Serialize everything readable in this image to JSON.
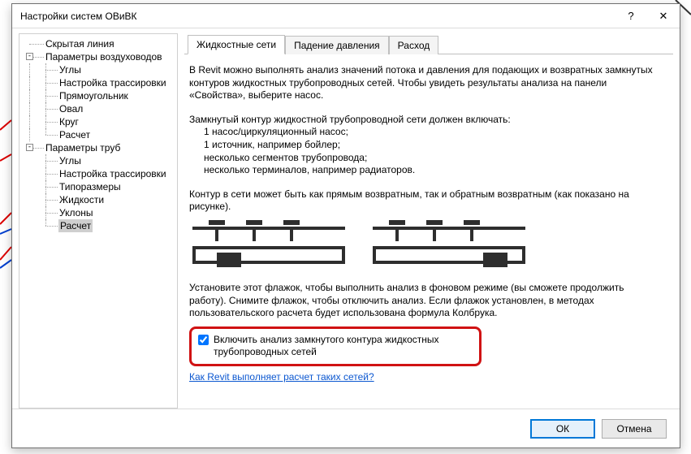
{
  "title": "Настройки систем ОВиВК",
  "titlebar": {
    "help_icon": "?",
    "close_icon": "✕"
  },
  "tree": {
    "n0": "Скрытая линия",
    "n1": "Параметры воздуховодов",
    "n1c": [
      "Углы",
      "Настройка трассировки",
      "Прямоугольник",
      "Овал",
      "Круг",
      "Расчет"
    ],
    "n2": "Параметры труб",
    "n2c": [
      "Углы",
      "Настройка трассировки",
      "Типоразмеры",
      "Жидкости",
      "Уклоны",
      "Расчет"
    ]
  },
  "tabs": {
    "t0": "Жидкостные сети",
    "t1": "Падение давления",
    "t2": "Расход"
  },
  "content": {
    "intro": "В Revit можно выполнять анализ значений потока и давления для подающих и возвратных замкнутых контуров жидкостных трубопроводных сетей. Чтобы увидеть результаты анализа на панели «Свойства», выберите насос.",
    "musthdr": "Замкнутый контур жидкостной трубопроводной сети должен включать:",
    "must1": "1 насос/циркуляционный насос;",
    "must2": "1 источник, например бойлер;",
    "must3": "несколько сегментов трубопровода;",
    "must4": "несколько терминалов, например радиаторов.",
    "loopnote": "Контур в сети может быть как прямым возвратным, так и обратным возвратным (как показано на рисунке).",
    "checkhelp": "Установите этот флажок, чтобы выполнить анализ в фоновом режиме (вы сможете продолжить работу). Снимите флажок, чтобы отключить анализ. Если флажок установлен, в методах пользовательского расчета будет использована формула Колбрука.",
    "checklabel": "Включить анализ замкнутого контура жидкостных трубопроводных сетей",
    "linktext": "Как Revit выполняет расчет таких сетей?"
  },
  "footer": {
    "ok": "ОК",
    "cancel": "Отмена"
  }
}
